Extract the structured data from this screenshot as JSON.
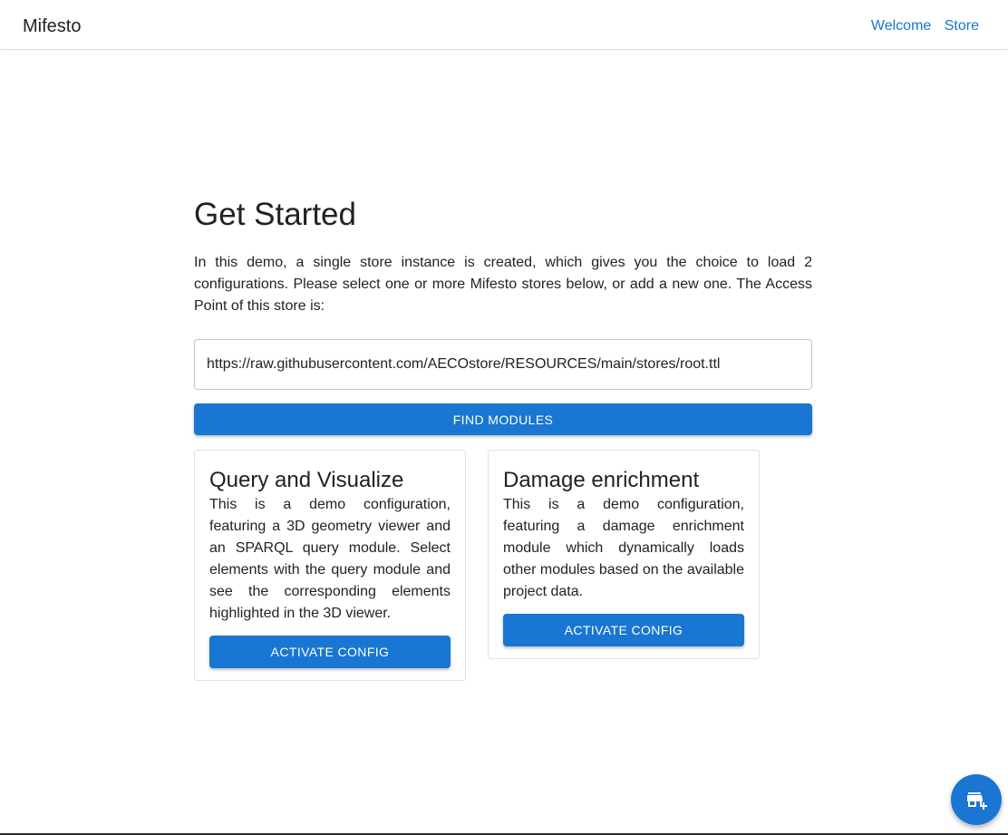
{
  "appbar": {
    "brand": "Mifesto",
    "nav": [
      {
        "label": "Welcome"
      },
      {
        "label": "Store"
      }
    ]
  },
  "main": {
    "title": "Get Started",
    "intro": "In this demo, a single store instance is created, which gives you the choice to load 2 configurations. Please select one or more Mifesto stores below, or add a new one. The Access Point of this store is:",
    "access_point": "https://raw.githubusercontent.com/AECOstore/RESOURCES/main/stores/root.ttl",
    "find_button": "FIND MODULES"
  },
  "cards": [
    {
      "title": "Query and Visualize",
      "description": "This is a demo configuration, featuring a 3D geometry viewer and an SPARQL query module. Select elements with the query module and see the corresponding elements highlighted in the 3D viewer.",
      "button": "ACTIVATE CONFIG"
    },
    {
      "title": "Damage enrichment",
      "description": "This is a demo configuration, featuring a damage enrichment module which dynamically loads other modules based on the available project data.",
      "button": "ACTIVATE CONFIG"
    }
  ],
  "fab": {
    "icon": "add-store-icon"
  },
  "colors": {
    "primary": "#1976d2",
    "text": "#222222",
    "border": "#e0e0e0"
  }
}
